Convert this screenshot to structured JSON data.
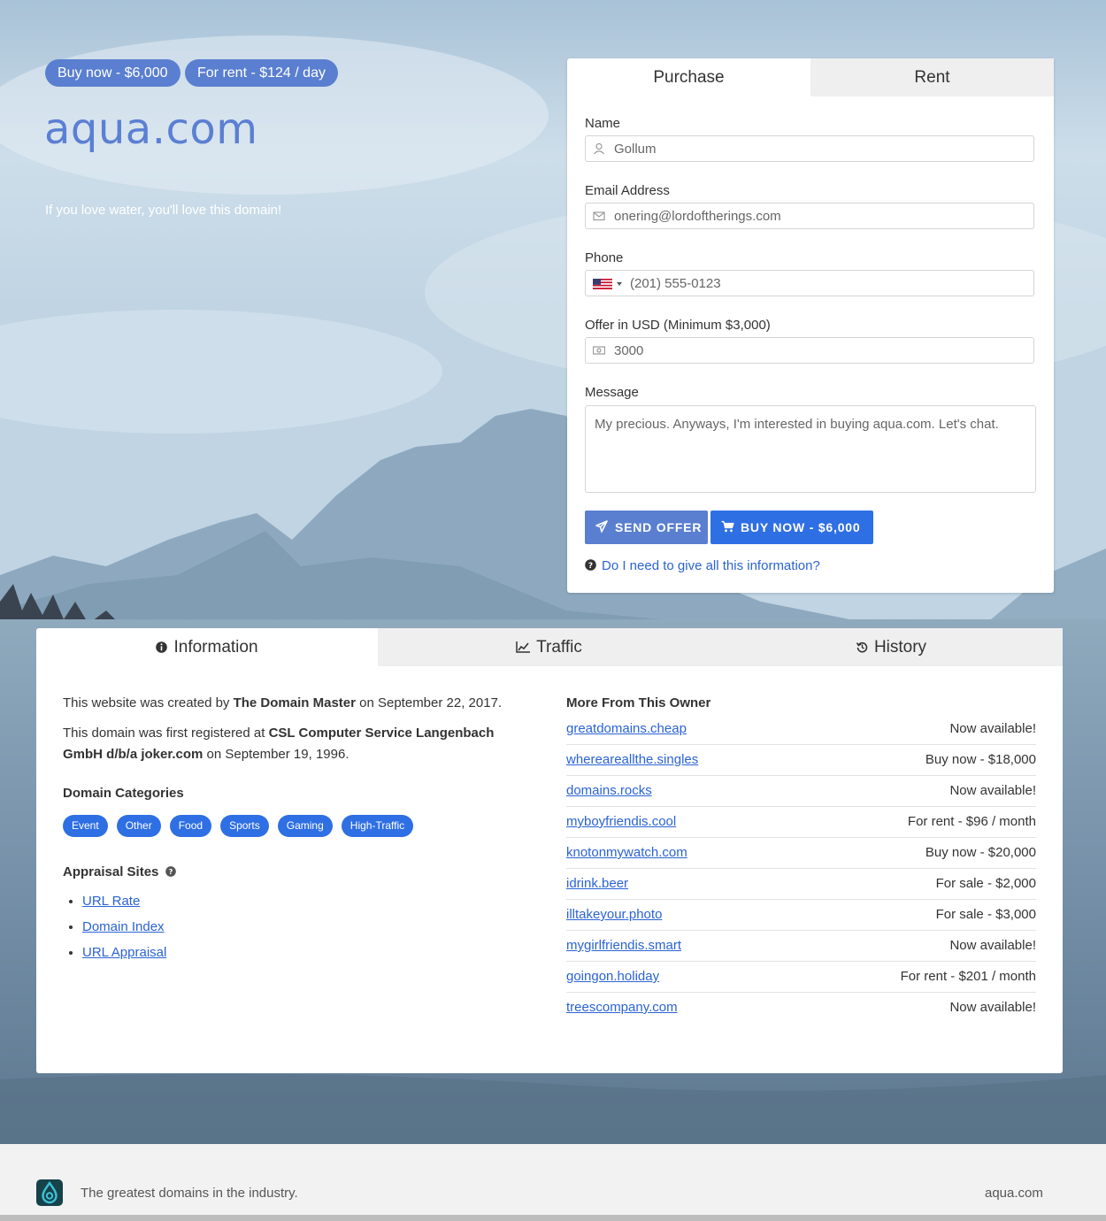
{
  "hero": {
    "buy_pill": "Buy now - $6,000",
    "rent_pill": "For rent - $124 / day",
    "domain": "aqua.com",
    "tagline": "If you love water, you'll love this domain!"
  },
  "form": {
    "tabs": [
      "Purchase",
      "Rent"
    ],
    "active_tab": "Purchase",
    "name_label": "Name",
    "name_value": "Gollum",
    "email_label": "Email Address",
    "email_value": "onering@lordoftherings.com",
    "phone_label": "Phone",
    "phone_value": "(201) 555-0123",
    "offer_label": "Offer in USD (Minimum $3,000)",
    "offer_value": "3000",
    "message_label": "Message",
    "message_value": "My precious. Anyways, I'm interested in buying aqua.com. Let's chat.",
    "send_button": "SEND OFFER",
    "buy_button": "BUY NOW - $6,000",
    "help_link": "Do I need to give all this information?",
    "colors": {
      "send": "#5a7fd0",
      "buy": "#2f6fe4",
      "link": "#2a63d4"
    }
  },
  "info": {
    "tabs": [
      {
        "label": "Information",
        "icon": "info-circle-icon"
      },
      {
        "label": "Traffic",
        "icon": "line-chart-icon"
      },
      {
        "label": "History",
        "icon": "history-icon"
      }
    ],
    "created_pre": "This website was created by ",
    "created_by": "The Domain Master",
    "created_post": " on September 22, 2017.",
    "registered_pre": "This domain was first registered at ",
    "registrar": "CSL Computer Service Langenbach GmbH d/b/a joker.com",
    "registered_post": " on September 19, 1996.",
    "categories_title": "Domain Categories",
    "categories": [
      "Event",
      "Other",
      "Food",
      "Sports",
      "Gaming",
      "High-Traffic"
    ],
    "appraisal_title": "Appraisal Sites",
    "appraisal_sites": [
      "URL Rate",
      "Domain Index",
      "URL Appraisal"
    ],
    "owner_title": "More From This Owner",
    "owner_domains": [
      {
        "name": "greatdomains.cheap",
        "status": "Now available!"
      },
      {
        "name": "whereareallthe.singles",
        "status": "Buy now - $18,000"
      },
      {
        "name": "domains.rocks",
        "status": "Now available!"
      },
      {
        "name": "myboyfriendis.cool",
        "status": "For rent - $96 / month"
      },
      {
        "name": "knotonmywatch.com",
        "status": "Buy now - $20,000"
      },
      {
        "name": "idrink.beer",
        "status": "For sale - $2,000"
      },
      {
        "name": "illtakeyour.photo",
        "status": "For sale - $3,000"
      },
      {
        "name": "mygirlfriendis.smart",
        "status": "Now available!"
      },
      {
        "name": "goingon.holiday",
        "status": "For rent - $201 / month"
      },
      {
        "name": "treescompany.com",
        "status": "Now available!"
      }
    ]
  },
  "footer": {
    "tagline": "The greatest domains in the industry.",
    "domain": "aqua.com"
  }
}
